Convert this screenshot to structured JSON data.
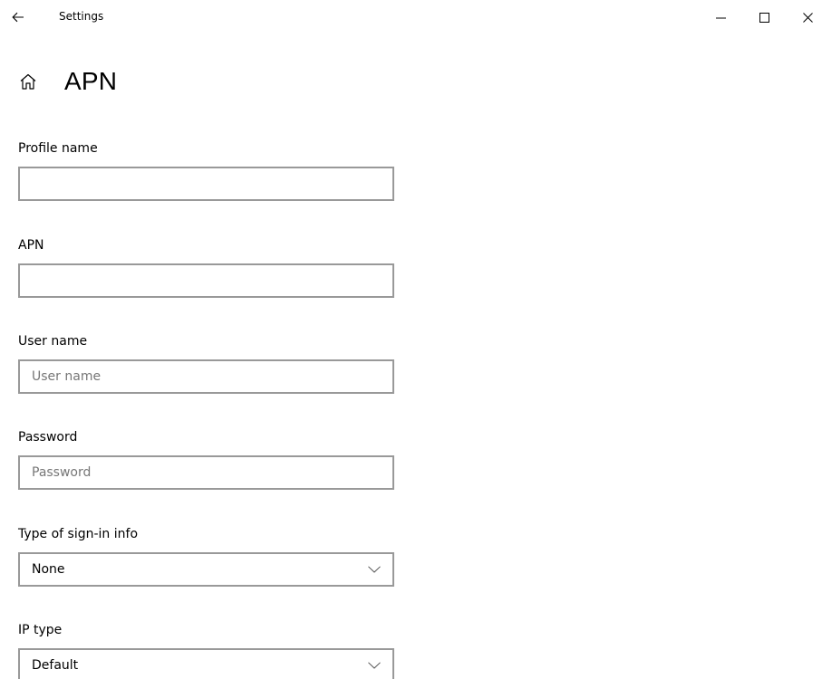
{
  "titlebar": {
    "app_title": "Settings"
  },
  "page": {
    "title": "APN"
  },
  "form": {
    "profile_name": {
      "label": "Profile name",
      "value": "",
      "placeholder": ""
    },
    "apn": {
      "label": "APN",
      "value": "",
      "placeholder": ""
    },
    "user_name": {
      "label": "User name",
      "value": "",
      "placeholder": "User name"
    },
    "password": {
      "label": "Password",
      "value": "",
      "placeholder": "Password"
    },
    "sign_in_type": {
      "label": "Type of sign-in info",
      "selected": "None"
    },
    "ip_type": {
      "label": "IP type",
      "selected": "Default"
    }
  },
  "icons": {
    "back": "back-arrow-icon",
    "home": "home-icon",
    "minimize": "minimize-icon",
    "maximize": "maximize-icon",
    "close": "close-icon",
    "dropdown": "chevron-down-icon"
  },
  "colors": {
    "background": "#ffffff",
    "text": "#000000",
    "border": "#999999",
    "placeholder": "#767676"
  }
}
